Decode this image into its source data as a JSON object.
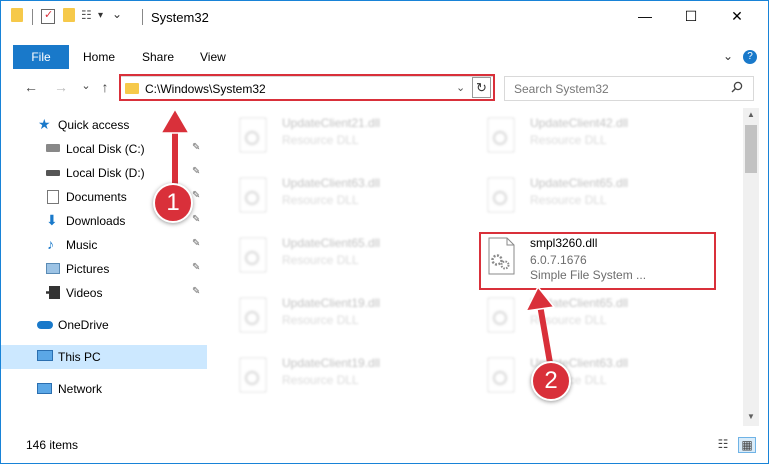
{
  "window": {
    "title": "System32",
    "controls": {
      "minimize": "—",
      "maximize": "☐",
      "close": "✕"
    }
  },
  "ribbon": {
    "tabs": [
      "File",
      "Home",
      "Share",
      "View"
    ],
    "expand_glyph": "⌄",
    "help_glyph": "?"
  },
  "nav": {
    "back": "←",
    "forward": "→",
    "recent": "⌄",
    "up": "↑",
    "address_path": "C:\\Windows\\System32",
    "address_dropdown": "⌄",
    "refresh": "↻",
    "search_placeholder": "Search System32",
    "search_glyph": "⚲"
  },
  "sidebar": {
    "items": [
      {
        "label": "Quick access",
        "icon": "star-icon",
        "pinned": false
      },
      {
        "label": "Local Disk (C:)",
        "icon": "drive-icon",
        "pinned": true
      },
      {
        "label": "Local Disk (D:)",
        "icon": "drive-icon",
        "pinned": true
      },
      {
        "label": "Documents",
        "icon": "documents-icon",
        "pinned": true
      },
      {
        "label": "Downloads",
        "icon": "downloads-icon",
        "pinned": true
      },
      {
        "label": "Music",
        "icon": "music-icon",
        "pinned": true
      },
      {
        "label": "Pictures",
        "icon": "pictures-icon",
        "pinned": true
      },
      {
        "label": "Videos",
        "icon": "videos-icon",
        "pinned": true
      },
      {
        "label": "OneDrive",
        "icon": "cloud-icon",
        "pinned": false
      },
      {
        "label": "This PC",
        "icon": "computer-icon",
        "pinned": false,
        "selected": true
      },
      {
        "label": "Network",
        "icon": "network-icon",
        "pinned": false
      }
    ],
    "pin_glyph": "📌"
  },
  "files": [
    {
      "name": "UpdateClient21.dll",
      "desc": "Resource DLL",
      "blurred": true
    },
    {
      "name": "UpdateClient42.dll",
      "desc": "Resource DLL",
      "blurred": true
    },
    {
      "name": "UpdateClient63.dll",
      "desc": "Resource DLL",
      "blurred": true
    },
    {
      "name": "UpdateClient65.dll",
      "desc": "Resource DLL",
      "blurred": true
    },
    {
      "name": "UpdateClient65.dll",
      "desc": "Resource DLL",
      "blurred": true
    },
    {
      "name": "smpl3260.dll",
      "desc": "6.0.7.1676",
      "desc2": "Simple File System ...",
      "blurred": false
    },
    {
      "name": "UpdateClient19.dll",
      "desc": "Resource DLL",
      "blurred": true
    },
    {
      "name": "UpdateClient65.dll",
      "desc": "Resource DLL",
      "blurred": true
    },
    {
      "name": "UpdateClient19.dll",
      "desc": "Resource DLL",
      "blurred": true
    },
    {
      "name": "UpdateClient63.dll",
      "desc": "Resource DLL",
      "blurred": true
    }
  ],
  "status": {
    "item_count": "146 items"
  },
  "annotations": {
    "step1": "1",
    "step2": "2",
    "color": "#d9303a"
  }
}
